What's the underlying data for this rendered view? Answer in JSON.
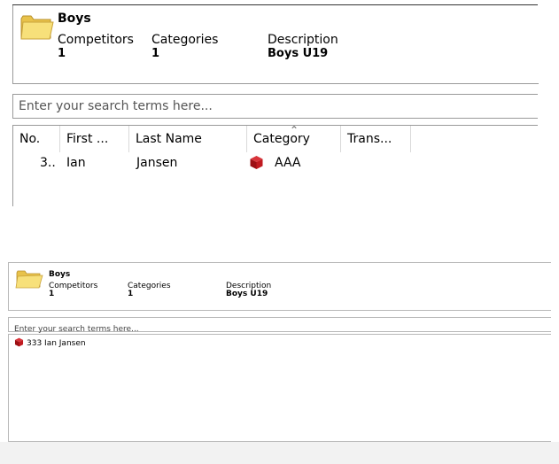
{
  "panel1": {
    "title": "Boys",
    "stats": {
      "competitors_label": "Competitors",
      "competitors_value": "1",
      "categories_label": "Categories",
      "categories_value": "1",
      "description_label": "Description",
      "description_value": "Boys U19"
    },
    "search_placeholder": "Enter your search terms here...",
    "columns": [
      "No.",
      "First ...",
      "Last Name",
      "Category",
      "Trans..."
    ],
    "rows": [
      {
        "no": "3..",
        "first": "Ian",
        "last": "Jansen",
        "category": "AAA",
        "trans": ""
      }
    ]
  },
  "panel2": {
    "title": "Boys",
    "stats": {
      "competitors_label": "Competitors",
      "competitors_value": "1",
      "categories_label": "Categories",
      "categories_value": "1",
      "description_label": "Description",
      "description_value": "Boys U19"
    },
    "search_placeholder": "Enter your search terms here...",
    "items": [
      {
        "label": "333 Ian Jansen"
      }
    ]
  },
  "icons": {
    "folder": "folder-icon",
    "category": "red-cube-icon"
  },
  "colors": {
    "folder_fill": "#f5dc6a",
    "cube_red": "#b01218"
  }
}
